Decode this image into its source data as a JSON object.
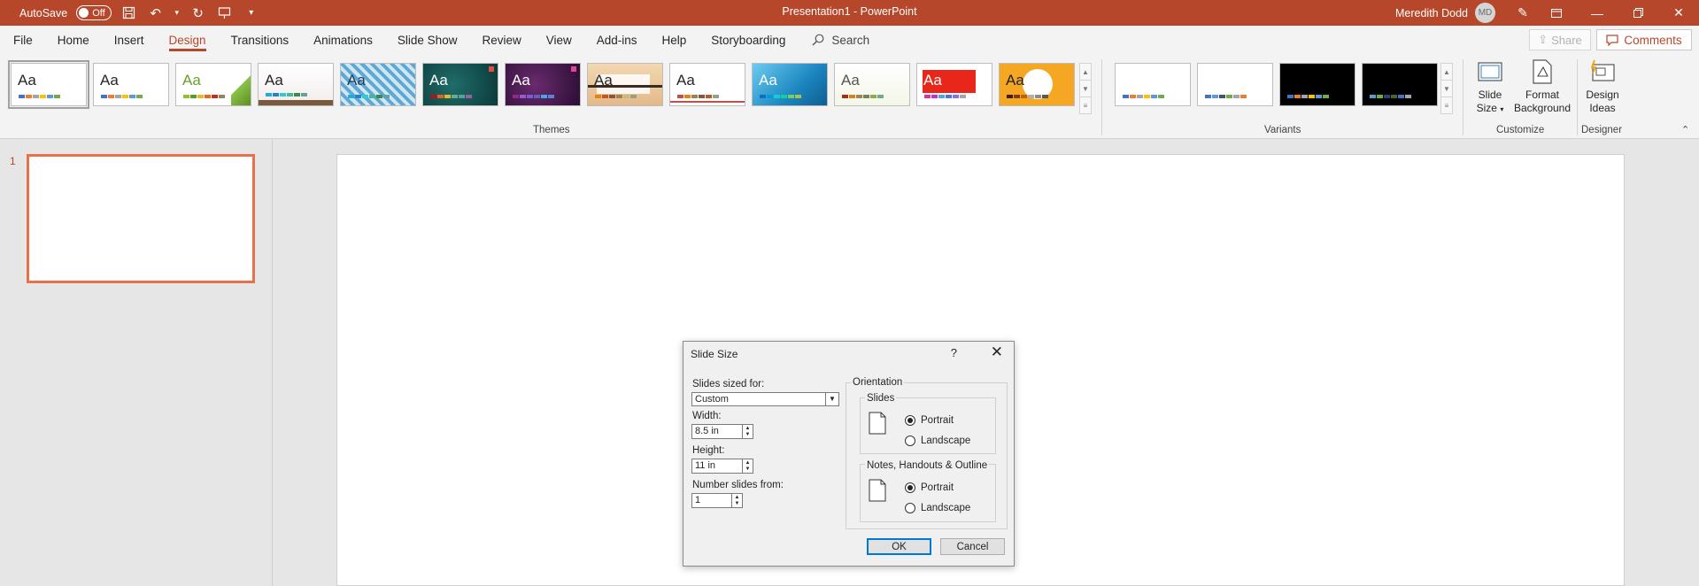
{
  "titlebar": {
    "autosave_label": "AutoSave",
    "autosave_state": "Off",
    "title": "Presentation1  -  PowerPoint",
    "user_name": "Meredith Dodd",
    "user_initials": "MD"
  },
  "tabs": [
    "File",
    "Home",
    "Insert",
    "Design",
    "Transitions",
    "Animations",
    "Slide Show",
    "Review",
    "View",
    "Add-ins",
    "Help",
    "Storyboarding"
  ],
  "active_tab": "Design",
  "search": {
    "placeholder": "Search"
  },
  "share_label": "Share",
  "comments_label": "Comments",
  "ribbon": {
    "themes_label": "Themes",
    "variants_label": "Variants",
    "customize_label": "Customize",
    "designer_label": "Designer",
    "theme_aa": "Aa",
    "slide_size": {
      "line1": "Slide",
      "line2": "Size"
    },
    "format_background": {
      "line1": "Format",
      "line2": "Background"
    },
    "design_ideas": {
      "line1": "Design",
      "line2": "Ideas"
    }
  },
  "slides": {
    "number": "1"
  },
  "dialog": {
    "title": "Slide Size",
    "help": "?",
    "sized_for_label": "Slides sized for:",
    "sized_for_value": "Custom",
    "width_label": "Width:",
    "width_value": "8.5 in",
    "height_label": "Height:",
    "height_value": "11 in",
    "number_from_label": "Number slides from:",
    "number_from_value": "1",
    "orientation_label": "Orientation",
    "slides_label": "Slides",
    "notes_label": "Notes, Handouts & Outline",
    "portrait": "Portrait",
    "landscape": "Landscape",
    "ok": "OK",
    "cancel": "Cancel"
  },
  "colors": {
    "accent": "#b7472a",
    "thumb_border": "#e8704a"
  }
}
